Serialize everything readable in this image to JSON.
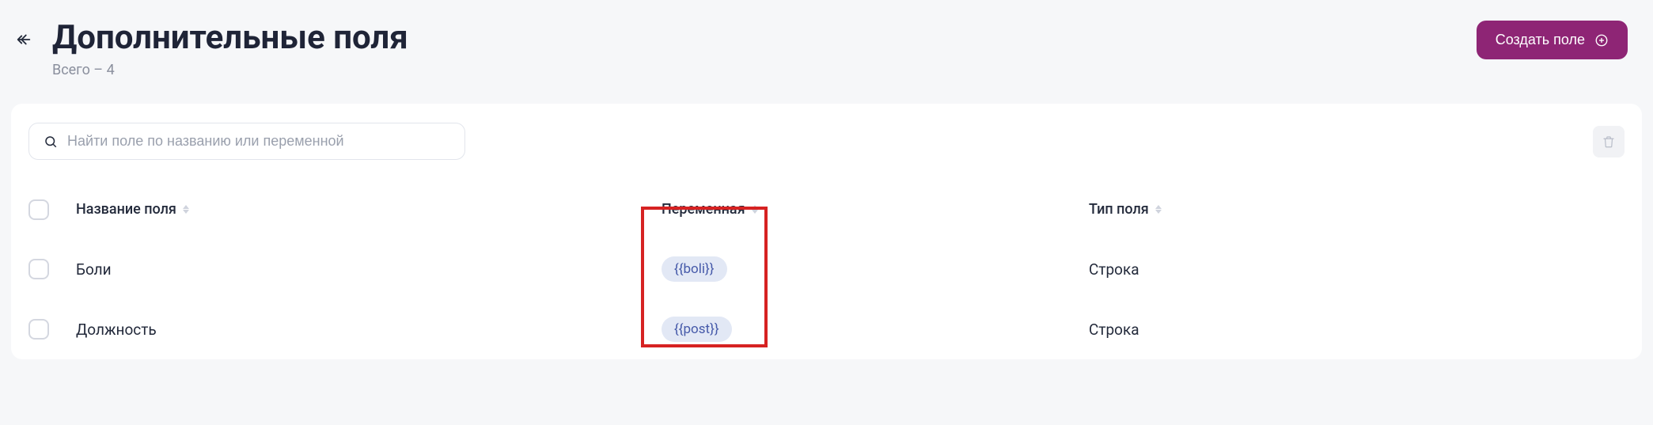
{
  "header": {
    "title": "Дополнительные поля",
    "subtitle": "Всего – 4",
    "create_label": "Создать поле"
  },
  "search": {
    "placeholder": "Найти поле по названию или переменной",
    "value": ""
  },
  "table": {
    "columns": {
      "name": "Название поля",
      "variable": "Переменная",
      "type": "Тип поля"
    },
    "rows": [
      {
        "name": "Боли",
        "variable": "{{boli}}",
        "type": "Строка"
      },
      {
        "name": "Должность",
        "variable": "{{post}}",
        "type": "Строка"
      }
    ]
  }
}
